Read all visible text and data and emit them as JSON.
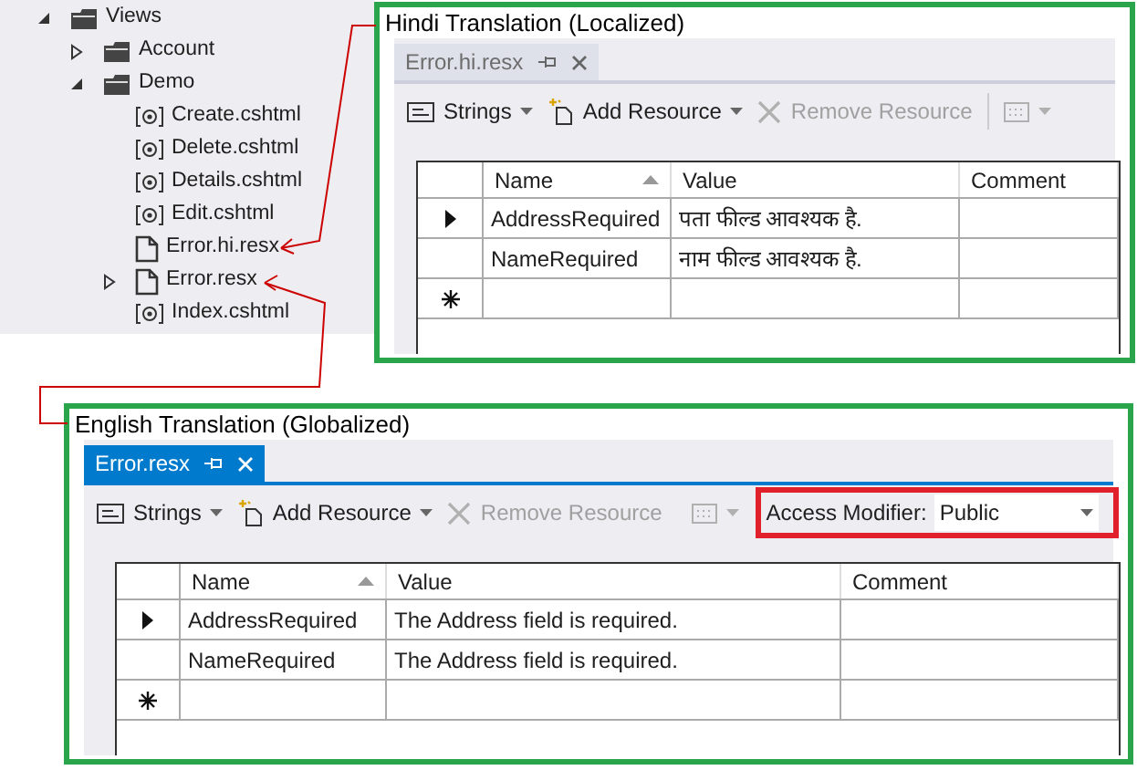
{
  "tree": [
    {
      "label": "Views",
      "kind": "folder",
      "expanded": true,
      "children": [
        {
          "label": "Account",
          "kind": "folder",
          "expanded": false
        },
        {
          "label": "Demo",
          "kind": "folder",
          "expanded": true,
          "children": [
            {
              "label": "Create.cshtml",
              "kind": "razor"
            },
            {
              "label": "Delete.cshtml",
              "kind": "razor"
            },
            {
              "label": "Details.cshtml",
              "kind": "razor"
            },
            {
              "label": "Edit.cshtml",
              "kind": "razor"
            },
            {
              "label": "Error.hi.resx",
              "kind": "resx"
            },
            {
              "label": "Error.resx",
              "kind": "resx",
              "expanded": false
            },
            {
              "label": "Index.cshtml",
              "kind": "razor"
            }
          ]
        }
      ]
    }
  ],
  "panels": [
    {
      "title": "Hindi Translation (Localized)",
      "tab": {
        "label": "Error.hi.resx",
        "selected": false
      },
      "toolbar": [
        {
          "kind": "strings",
          "label": "Strings",
          "disabled": false
        },
        {
          "kind": "add",
          "label": "Add Resource",
          "disabled": false
        },
        {
          "kind": "remove",
          "label": "Remove Resource",
          "disabled": true
        },
        {
          "kind": "view",
          "disabled": true
        }
      ],
      "columns": [
        "Name",
        "Value",
        "Comment"
      ],
      "rows": [
        {
          "kind": "current",
          "cells": [
            "AddressRequired",
            "पता फील्ड आवश्यक है.",
            ""
          ]
        },
        {
          "kind": "normal",
          "cells": [
            "NameRequired",
            "नाम फील्ड आवश्यक है.",
            ""
          ]
        },
        {
          "kind": "new",
          "cells": [
            "",
            "",
            ""
          ]
        }
      ]
    },
    {
      "title": "English Translation (Globalized)",
      "tab": {
        "label": "Error.resx",
        "selected": true
      },
      "toolbar": [
        {
          "kind": "strings",
          "label": "Strings",
          "disabled": false
        },
        {
          "kind": "add",
          "label": "Add Resource",
          "disabled": false
        },
        {
          "kind": "remove",
          "label": "Remove Resource",
          "disabled": true
        },
        {
          "kind": "view",
          "disabled": true
        }
      ],
      "access_modifier": {
        "label": "Access Modifier:",
        "value": "Public"
      },
      "columns": [
        "Name",
        "Value",
        "Comment"
      ],
      "rows": [
        {
          "kind": "current",
          "cells": [
            "AddressRequired",
            "The Address field is required.",
            ""
          ]
        },
        {
          "kind": "normal",
          "cells": [
            "NameRequired",
            "The Address field is required.",
            ""
          ]
        },
        {
          "kind": "new",
          "cells": [
            "",
            "",
            ""
          ]
        }
      ]
    }
  ]
}
